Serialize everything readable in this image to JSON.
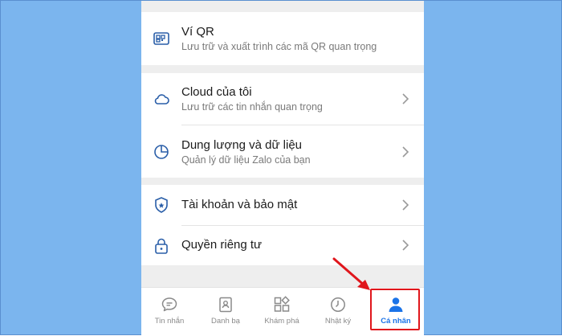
{
  "menu": {
    "vi_qr": {
      "title": "Ví QR",
      "subtitle": "Lưu trữ và xuất trình các mã QR quan trọng",
      "icon": "qr-wallet-icon"
    },
    "cloud": {
      "title": "Cloud của tôi",
      "subtitle": "Lưu trữ các tin nhắn quan trọng",
      "icon": "cloud-icon"
    },
    "storage": {
      "title": "Dung lượng và dữ liệu",
      "subtitle": "Quản lý dữ liệu Zalo của bạn",
      "icon": "pie-chart-icon"
    },
    "account": {
      "title": "Tài khoản và bảo mật",
      "icon": "shield-icon"
    },
    "privacy": {
      "title": "Quyền riêng tư",
      "icon": "lock-icon"
    }
  },
  "bottom_nav": {
    "items": [
      {
        "label": "Tin nhắn",
        "icon": "chat-bubble-icon",
        "active": false
      },
      {
        "label": "Danh bạ",
        "icon": "contacts-icon",
        "active": false
      },
      {
        "label": "Khám phá",
        "icon": "grid-icon",
        "active": false
      },
      {
        "label": "Nhật ký",
        "icon": "clock-icon",
        "active": false
      },
      {
        "label": "Cá nhân",
        "icon": "person-icon",
        "active": true
      }
    ]
  },
  "colors": {
    "background": "#7bb5ee",
    "accent": "#1a73e8",
    "icon_blue": "#2a5ea8",
    "annotation_red": "#e0161c"
  }
}
